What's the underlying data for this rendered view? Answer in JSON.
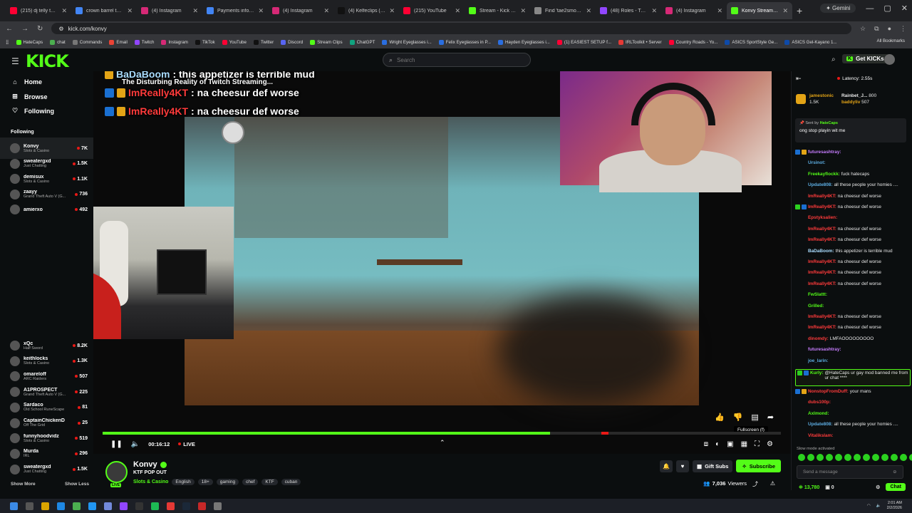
{
  "browser": {
    "tabs": [
      {
        "label": "(215) dj telly tellz - Y",
        "color": "#ff0033"
      },
      {
        "label": "crown barrel twist - G",
        "color": "#4285f4"
      },
      {
        "label": "(4) Instagram",
        "color": "#d62976"
      },
      {
        "label": "Payments info - Paym",
        "color": "#4285f4"
      },
      {
        "label": "(4) Instagram",
        "color": "#d62976"
      },
      {
        "label": "(4) Kelfeclips (@keif",
        "color": "#111111"
      },
      {
        "label": "(215) YouTube",
        "color": "#ff0033"
      },
      {
        "label": "Stream - Kick Dashb",
        "color": "#53fc18"
      },
      {
        "label": "Find 'tae2smooth jas",
        "color": "#888888"
      },
      {
        "label": "(48) Roles - Twitch",
        "color": "#9146ff"
      },
      {
        "label": "(4) Instagram",
        "color": "#d62976"
      },
      {
        "label": "Konvy Stream - W",
        "color": "#53fc18",
        "active": true
      }
    ],
    "gemini_label": "Gemini",
    "url": "kick.com/konvy",
    "bookmarks": [
      "HateCaps",
      "chat",
      "Commands",
      "Email",
      "Twitch",
      "Instagram",
      "TikTok",
      "YouTube",
      "Twitter",
      "Discord",
      "Stream Clips",
      "ChatGPT",
      "Wright Eyeglasses i...",
      "Felix Eyeglasses in P...",
      "Hayden Eyeglasses i...",
      "(1) EASIEST SETUP f...",
      "IRLToolkit • Server",
      "Country Roads - Yo...",
      "ASICS SportStyle Ge...",
      "ASICS Gel-Kayano 1..."
    ],
    "all_bookmarks": "All Bookmarks"
  },
  "header": {
    "logo": "KICK",
    "search_placeholder": "Search",
    "get_kicks": "Get KICKs"
  },
  "sidebar": {
    "nav": [
      {
        "label": "Home",
        "icon": "home-icon"
      },
      {
        "label": "Browse",
        "icon": "browse-icon"
      },
      {
        "label": "Following",
        "icon": "heart-icon"
      }
    ],
    "following_heading": "Following",
    "channels_top": [
      {
        "name": "Konvy",
        "category": "Slots & Casino",
        "viewers": "7K",
        "selected": true
      },
      {
        "name": "sweatergxd",
        "category": "Just Chatting",
        "viewers": "1.5K"
      },
      {
        "name": "demisux",
        "category": "Slots & Casino",
        "viewers": "1.1K"
      },
      {
        "name": "zaayy",
        "category": "Grand Theft Auto V (G...",
        "viewers": "736"
      },
      {
        "name": "amierxo",
        "category": "",
        "viewers": "492"
      }
    ],
    "channels_bottom": [
      {
        "name": "xQc",
        "category": "Half Sword",
        "viewers": "8.2K"
      },
      {
        "name": "keithlocks",
        "category": "Slots & Casino",
        "viewers": "1.3K"
      },
      {
        "name": "omareloff",
        "category": "ARC Raiders",
        "viewers": "507"
      },
      {
        "name": "A1PROSPECT",
        "category": "Grand Theft Auto V (G...",
        "viewers": "225"
      },
      {
        "name": "Sardaco",
        "category": "Old School RuneScape",
        "viewers": "81"
      },
      {
        "name": "CaptainChickenD",
        "category": "Off The Grid",
        "viewers": "25"
      },
      {
        "name": "funnyhoodvidz",
        "category": "Slots & Casino",
        "viewers": "519"
      },
      {
        "name": "Murda",
        "category": "IRL",
        "viewers": "296"
      },
      {
        "name": "sweatergxd",
        "category": "Just Chatting",
        "viewers": "1.5K"
      }
    ],
    "show_more": "Show More",
    "show_less": "Show Less"
  },
  "player": {
    "overlay_lines": [
      {
        "user": "BaDaBoom",
        "text": ": this appetizer is terrible mud",
        "style": "blue"
      },
      {
        "user": "ImReally4KT",
        "text": ": na cheesur def worse",
        "style": "red"
      },
      {
        "user": "ImReally4KT",
        "text": ": na cheesur def worse",
        "style": "red"
      }
    ],
    "overlay_subtitle": "The Disturbing Reality of Twitch Streaming...",
    "time": "00:16:12",
    "live_label": "LIVE",
    "progress": 0.66,
    "fullscreen_tooltip": "Fullscreen (f)"
  },
  "channel": {
    "name": "Konvy",
    "title": "KTF POP OUT",
    "category": "Slots & Casino",
    "tags": [
      "English",
      "18+",
      "gaming",
      "chef",
      "KTF",
      "cuban"
    ],
    "gift_subs": "Gift Subs",
    "subscribe": "Subscribe",
    "viewers": "7,036",
    "viewers_label": "Viewers",
    "avatar_live": "LIVE"
  },
  "chat": {
    "latency": "Latency: 2.55s",
    "gifters": [
      {
        "name": "jamestonic",
        "count": "1.5K"
      },
      {
        "name": "Rainbet_J...",
        "count": "800"
      },
      {
        "name": "baddyliv",
        "count": "507"
      }
    ],
    "pinned_by_label": "Sent by",
    "pinned_by": "HateCaps",
    "pinned_msg": "ong stop playin wit me",
    "messages": [
      {
        "user": "futuresashtray:",
        "text": "",
        "color": "#c77dff"
      },
      {
        "user": "Ursinot:",
        "text": "",
        "color": "#5dade2"
      },
      {
        "user": "Freekayflockk:",
        "text": "fuck hatecaps",
        "color": "#53fc18"
      },
      {
        "user": "Update808:",
        "text": "all these people your homies ....",
        "color": "#5dade2"
      },
      {
        "user": "ImReally4KT:",
        "text": "na cheesur def worse",
        "color": "#ff3b3b"
      },
      {
        "user": "ImReally4KT:",
        "text": "na cheesur def worse",
        "color": "#ff3b3b"
      },
      {
        "user": "Epstyksalien:",
        "text": "",
        "color": "#ff3b3b"
      },
      {
        "user": "ImReally4KT:",
        "text": "na cheesur def worse",
        "color": "#ff3b3b"
      },
      {
        "user": "ImReally4KT:",
        "text": "na cheesur def worse",
        "color": "#ff3b3b"
      },
      {
        "user": "BaDaBoom:",
        "text": "this appetizer is terrible mud",
        "color": "#aaddff"
      },
      {
        "user": "ImReally4KT:",
        "text": "na cheesur def worse",
        "color": "#ff3b3b"
      },
      {
        "user": "ImReally4KT:",
        "text": "na cheesur def worse",
        "color": "#ff3b3b"
      },
      {
        "user": "ImReally4KT:",
        "text": "na cheesur def worse",
        "color": "#ff3b3b"
      },
      {
        "user": "FwSlattt:",
        "text": "",
        "color": "#53fc18"
      },
      {
        "user": "Grilled:",
        "text": "",
        "color": "#53fc18"
      },
      {
        "user": "ImReally4KT:",
        "text": "na cheesur def worse",
        "color": "#ff3b3b"
      },
      {
        "user": "ImReally4KT:",
        "text": "na cheesur def worse",
        "color": "#ff3b3b"
      },
      {
        "user": "dinomdy:",
        "text": "LMFAOOOOOOOOO",
        "color": "#ff3b3b"
      },
      {
        "user": "futuresashtray:",
        "text": "",
        "color": "#c77dff"
      },
      {
        "user": "joe_larin:",
        "text": "",
        "color": "#5dade2"
      }
    ],
    "highlight": {
      "user": "Kurly:",
      "text": "@HateCaps ur gay mod banned me from ur chat ****",
      "color": "#53fc18"
    },
    "messages_after": [
      {
        "user": "NonstopFromDuff:",
        "text": "your mans",
        "color": "#ff3b3b"
      },
      {
        "user": "dubs100p:",
        "text": "",
        "color": "#ff3b3b"
      },
      {
        "user": "Axlmond:",
        "text": "",
        "color": "#53fc18"
      },
      {
        "user": "Update808:",
        "text": "all these people your homies ....",
        "color": "#5dade2"
      },
      {
        "user": "Vitalikslam:",
        "text": "",
        "color": "#ff3b3b"
      }
    ],
    "slow_mode": "Slow mode activated",
    "send_placeholder": "Send a message",
    "kicks_balance": "13,780",
    "points": "0",
    "chat_button": "Chat"
  },
  "taskbar": {
    "time": "2:01 AM",
    "date": "2/2/2026"
  }
}
